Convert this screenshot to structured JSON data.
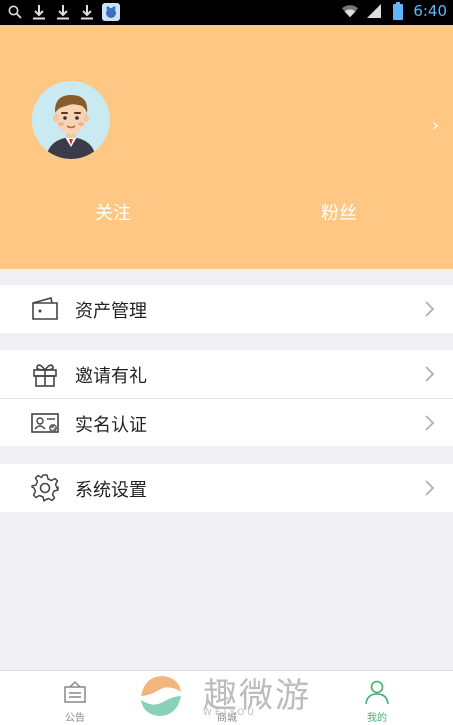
{
  "status_bar": {
    "time": "6:40",
    "icons": [
      "search-icon",
      "download-icon",
      "download-icon",
      "download-icon",
      "app-notification-icon",
      "wifi-icon",
      "signal-icon",
      "battery-icon"
    ]
  },
  "profile": {
    "avatar": "avatar",
    "follow_label": "关注",
    "fans_label": "粉丝",
    "arrow": "›"
  },
  "menu": {
    "assets": {
      "label": "资产管理",
      "icon": "wallet-icon"
    },
    "invite": {
      "label": "邀请有礼",
      "icon": "gift-icon"
    },
    "realname": {
      "label": "实名认证",
      "icon": "id-card-icon"
    },
    "settings": {
      "label": "系统设置",
      "icon": "gear-icon"
    }
  },
  "tabbar": {
    "tabs": [
      {
        "label": "公告",
        "icon": "notice-icon",
        "active": false
      },
      {
        "label": "商城",
        "icon": "shop-icon",
        "active": false
      },
      {
        "label": "我的",
        "icon": "user-icon",
        "active": true
      }
    ],
    "accent_color": "#3fb36f"
  },
  "watermark": {
    "text": "趣微游",
    "subtext": "WEIYOU"
  },
  "colors": {
    "header_bg": "#ffc784",
    "page_bg": "#efeff4",
    "active_tab": "#3fb36f"
  }
}
